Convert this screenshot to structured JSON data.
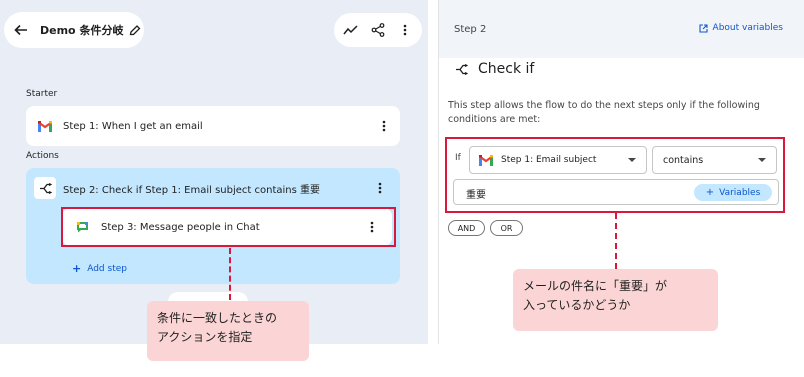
{
  "header": {
    "title": "Demo 条件分岐"
  },
  "flow": {
    "starter_label": "Starter",
    "actions_label": "Actions",
    "step1": {
      "prefix": "Step 1:",
      "text": " When I get an email"
    },
    "step2": {
      "prefix": "Step 2:",
      "text": " Check if Step 1: Email subject contains 重要"
    },
    "step3": {
      "prefix": "Step 3:",
      "text": " Message people in Chat"
    },
    "add_step": "Add step"
  },
  "panel": {
    "step_label": "Step 2",
    "about_link": "About variables",
    "title": "Check if",
    "description": "This step allows the flow to do the next steps only if the following conditions are met:",
    "if_label": "If",
    "field_select": "Step 1: Email subject",
    "operator_select": "contains",
    "value": "重要",
    "variables_button": "Variables",
    "and_button": "AND",
    "or_button": "OR"
  },
  "annotations": {
    "left_callout": [
      "条件に一致したときの",
      "アクションを指定"
    ],
    "right_callout": [
      "メールの件名に「重要」が",
      "入っているかどうか"
    ]
  },
  "colors": {
    "accent": "#0b57d0",
    "highlight": "#d9183b",
    "callout_bg": "#fbd5d5",
    "selected_step_bg": "#c2e7ff",
    "canvas_bg": "#e9eef6"
  }
}
